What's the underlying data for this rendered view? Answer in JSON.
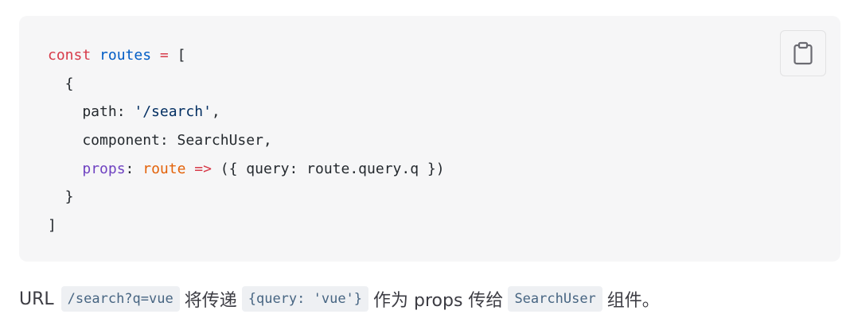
{
  "code_block": {
    "lines": [
      [
        {
          "t": "const",
          "c": "kw"
        },
        {
          "t": " ",
          "c": "plain"
        },
        {
          "t": "routes",
          "c": "var"
        },
        {
          "t": " ",
          "c": "plain"
        },
        {
          "t": "=",
          "c": "kw"
        },
        {
          "t": " [",
          "c": "plain"
        }
      ],
      [
        {
          "t": "  {",
          "c": "plain"
        }
      ],
      [
        {
          "t": "    path: ",
          "c": "plain"
        },
        {
          "t": "'/search'",
          "c": "str"
        },
        {
          "t": ",",
          "c": "plain"
        }
      ],
      [
        {
          "t": "    component: SearchUser,",
          "c": "plain"
        }
      ],
      [
        {
          "t": "    ",
          "c": "plain"
        },
        {
          "t": "props",
          "c": "prop"
        },
        {
          "t": ": ",
          "c": "plain"
        },
        {
          "t": "route",
          "c": "param"
        },
        {
          "t": " ",
          "c": "plain"
        },
        {
          "t": "=>",
          "c": "kw"
        },
        {
          "t": " ({ query: route.query.q })",
          "c": "plain"
        }
      ],
      [
        {
          "t": "  }",
          "c": "plain"
        }
      ],
      [
        {
          "t": "]",
          "c": "plain"
        }
      ]
    ],
    "copy_icon": "clipboard-icon"
  },
  "paragraph": {
    "prefix": "URL",
    "code1": "/search?q=vue",
    "text1": "将传递",
    "code2": "{query: 'vue'}",
    "text2": "作为 props 传给",
    "code3": "SearchUser",
    "text3": "组件。"
  }
}
